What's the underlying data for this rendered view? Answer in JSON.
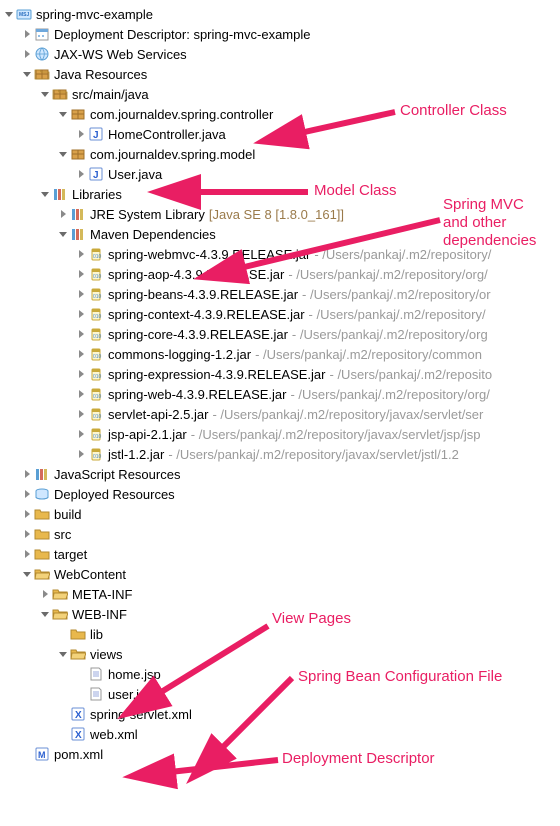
{
  "root": {
    "label": "spring-mvc-example"
  },
  "n1": {
    "label": "Deployment Descriptor: spring-mvc-example"
  },
  "n2": {
    "label": "JAX-WS Web Services"
  },
  "n3": {
    "label": "Java Resources"
  },
  "n4": {
    "label": "src/main/java"
  },
  "n5": {
    "label": "com.journaldev.spring.controller"
  },
  "n6": {
    "label": "HomeController.java"
  },
  "n7": {
    "label": "com.journaldev.spring.model"
  },
  "n8": {
    "label": "User.java"
  },
  "n9": {
    "label": "Libraries"
  },
  "n10": {
    "label": "JRE System Library",
    "suffix": "[Java SE 8 [1.8.0_161]]"
  },
  "n11": {
    "label": "Maven Dependencies"
  },
  "jar1": {
    "label": "spring-webmvc-4.3.9.RELEASE.jar",
    "suffix": "- /Users/pankaj/.m2/repository/"
  },
  "jar2": {
    "label": "spring-aop-4.3.9.RELEASE.jar",
    "suffix": "- /Users/pankaj/.m2/repository/org/"
  },
  "jar3": {
    "label": "spring-beans-4.3.9.RELEASE.jar",
    "suffix": "- /Users/pankaj/.m2/repository/or"
  },
  "jar4": {
    "label": "spring-context-4.3.9.RELEASE.jar",
    "suffix": "- /Users/pankaj/.m2/repository/"
  },
  "jar5": {
    "label": "spring-core-4.3.9.RELEASE.jar",
    "suffix": "- /Users/pankaj/.m2/repository/org"
  },
  "jar6": {
    "label": "commons-logging-1.2.jar",
    "suffix": "- /Users/pankaj/.m2/repository/common"
  },
  "jar7": {
    "label": "spring-expression-4.3.9.RELEASE.jar",
    "suffix": "- /Users/pankaj/.m2/reposito"
  },
  "jar8": {
    "label": "spring-web-4.3.9.RELEASE.jar",
    "suffix": "- /Users/pankaj/.m2/repository/org/"
  },
  "jar9": {
    "label": "servlet-api-2.5.jar",
    "suffix": "- /Users/pankaj/.m2/repository/javax/servlet/ser"
  },
  "jar10": {
    "label": "jsp-api-2.1.jar",
    "suffix": "- /Users/pankaj/.m2/repository/javax/servlet/jsp/jsp"
  },
  "jar11": {
    "label": "jstl-1.2.jar",
    "suffix": "- /Users/pankaj/.m2/repository/javax/servlet/jstl/1.2"
  },
  "n20": {
    "label": "JavaScript Resources"
  },
  "n21": {
    "label": "Deployed Resources"
  },
  "n22": {
    "label": "build"
  },
  "n23": {
    "label": "src"
  },
  "n24": {
    "label": "target"
  },
  "n25": {
    "label": "WebContent"
  },
  "n26": {
    "label": "META-INF"
  },
  "n27": {
    "label": "WEB-INF"
  },
  "n28": {
    "label": "lib"
  },
  "n29": {
    "label": "views"
  },
  "n30": {
    "label": "home.jsp"
  },
  "n31": {
    "label": "user.jsp"
  },
  "n32": {
    "label": "spring-servlet.xml"
  },
  "n33": {
    "label": "web.xml"
  },
  "n34": {
    "label": "pom.xml"
  },
  "ann": {
    "a1": "Controller Class",
    "a2": "Model Class",
    "a3": "Spring MVC\nand other\ndependencies",
    "a4": "View Pages",
    "a5": "Spring Bean Configuration File",
    "a6": "Deployment Descriptor"
  }
}
